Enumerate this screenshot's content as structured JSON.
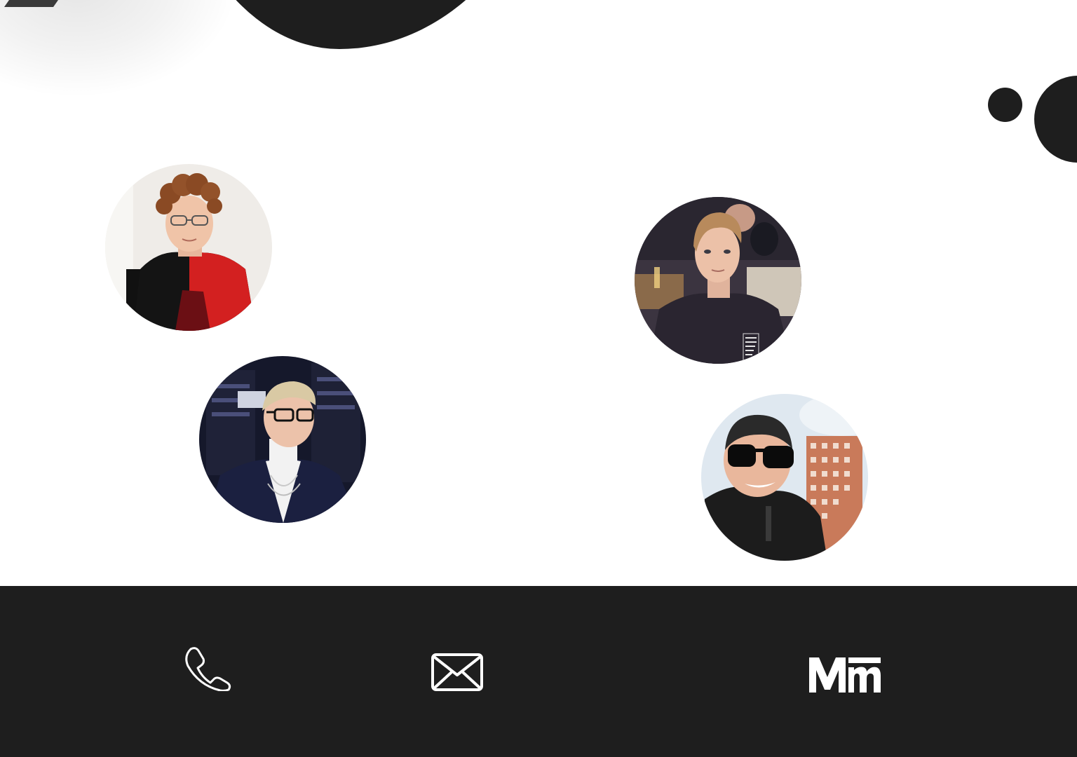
{
  "team": {
    "members": [
      {
        "photo_icon": "member-photo-curly-hair-glasses",
        "shirt_color": "#d32020"
      },
      {
        "photo_icon": "member-photo-blond-glasses-suit",
        "jacket_color": "#1b2040"
      },
      {
        "photo_icon": "member-photo-young-man-dark-sweatshirt",
        "sweatshirt_color": "#2a2530"
      },
      {
        "photo_icon": "member-photo-sunglasses-outdoor",
        "jacket_color": "#1c1c1c"
      }
    ]
  },
  "footer": {
    "background": "#1e1e1e",
    "icon_color": "#ffffff",
    "links": [
      {
        "icon": "phone-icon"
      },
      {
        "icon": "mail-icon"
      },
      {
        "icon": "brand-logo-icon"
      }
    ]
  },
  "decor": {
    "shape_color": "#1e1e1e"
  }
}
